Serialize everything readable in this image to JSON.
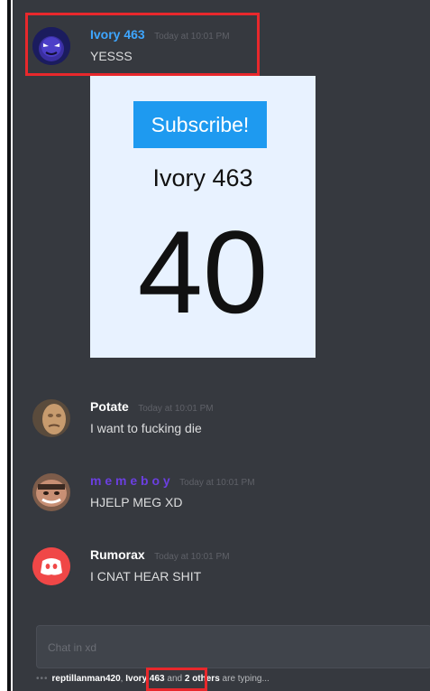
{
  "messages": [
    {
      "username": "Ivory 463",
      "timestamp": "Today at 10:01 PM",
      "text": "YESSS",
      "color": "#3ea6ff"
    },
    {
      "username": "Potate",
      "timestamp": "Today at 10:01 PM",
      "text": "I want to fucking die",
      "color": "#ffffff"
    },
    {
      "username": "m e m e b o y",
      "timestamp": "Today at 10:01 PM",
      "text": "HJELP MEG XD",
      "color": "#6b3fe0"
    },
    {
      "username": "Rumorax",
      "timestamp": "Today at 10:01 PM",
      "text": "I CNAT HEAR SHIT",
      "color": "#ffffff"
    }
  ],
  "embed": {
    "subscribe_label": "Subscribe!",
    "channel_name": "Ivory 463",
    "count": "40"
  },
  "input": {
    "placeholder": "Chat in xd"
  },
  "typing": {
    "user1": "reptillanman420",
    "user2": "Ivory 463",
    "mid": "and",
    "others": "2 others",
    "suffix": "are typing..."
  },
  "colors": {
    "accent_red": "#e8282c",
    "discord_red": "#f04747"
  }
}
